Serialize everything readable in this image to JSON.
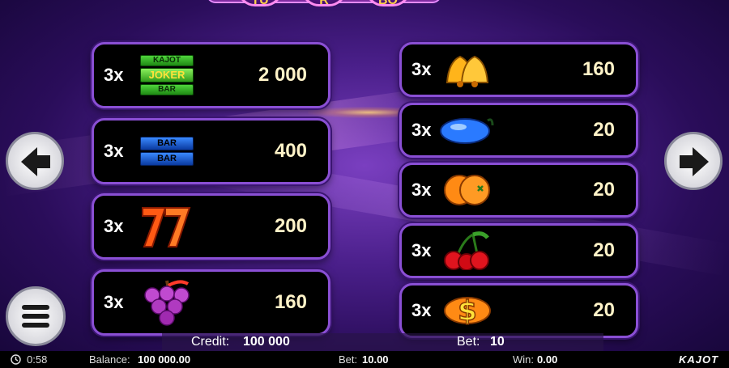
{
  "header": {
    "logo_letters": [
      "TU",
      "R",
      "BO"
    ]
  },
  "paytable": {
    "left": [
      {
        "multiplier": "3x",
        "symbol": "joker-bar",
        "joker_text": [
          "KAJOT",
          "JOKER",
          "BAR"
        ],
        "value": "2 000"
      },
      {
        "multiplier": "3x",
        "symbol": "double-bar",
        "bar_text": [
          "BAR",
          "BAR"
        ],
        "value": "400"
      },
      {
        "multiplier": "3x",
        "symbol": "seven",
        "value": "200"
      },
      {
        "multiplier": "3x",
        "symbol": "grapes",
        "value": "160"
      }
    ],
    "right": [
      {
        "multiplier": "3x",
        "symbol": "bell",
        "value": "160"
      },
      {
        "multiplier": "3x",
        "symbol": "plum",
        "value": "20"
      },
      {
        "multiplier": "3x",
        "symbol": "orange",
        "value": "20"
      },
      {
        "multiplier": "3x",
        "symbol": "cherry",
        "value": "20"
      },
      {
        "multiplier": "3x",
        "symbol": "dollar",
        "value": "20"
      }
    ]
  },
  "credit": {
    "credit_label": "Credit:",
    "credit_value": "100 000",
    "bet_label": "Bet:",
    "bet_value": "10"
  },
  "status": {
    "time": "0:58",
    "balance_label": "Balance:",
    "balance_value": "100 000.00",
    "bet_label": "Bet:",
    "bet_value": "10.00",
    "win_label": "Win:",
    "win_value": "0.00",
    "brand": "KAJOT"
  },
  "colors": {
    "panel_border": "#8a4fd4",
    "value_text": "#fff3c8",
    "background": "#4a1f8a"
  }
}
